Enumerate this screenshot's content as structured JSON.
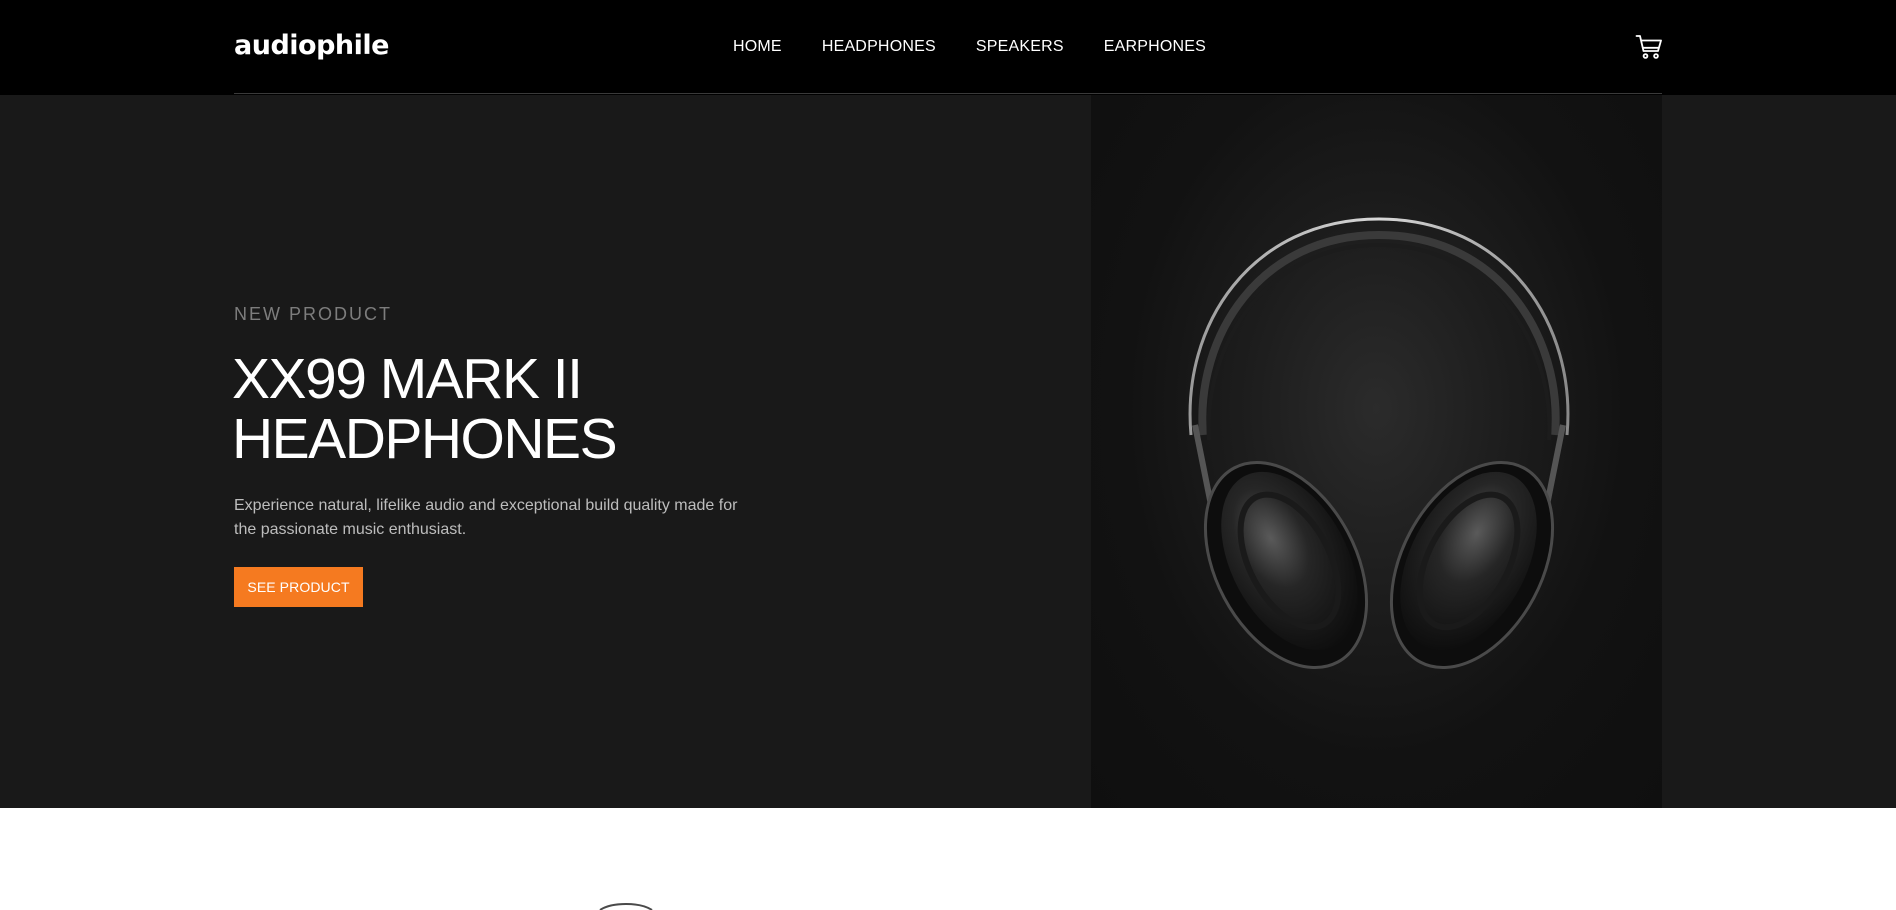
{
  "header": {
    "logo": "audiophile",
    "nav": [
      {
        "label": "HOME"
      },
      {
        "label": "HEADPHONES"
      },
      {
        "label": "SPEAKERS"
      },
      {
        "label": "EARPHONES"
      }
    ],
    "cart_icon": "cart-icon"
  },
  "hero": {
    "overline": "NEW PRODUCT",
    "title_line1": "XX99 MARK II",
    "title_line2": "HEADPHONES",
    "description": "Experience natural, lifelike audio and exceptional build quality made for the passionate music enthusiast.",
    "cta_label": "SEE PRODUCT",
    "image": "headphones-image"
  },
  "colors": {
    "accent": "#f57a20",
    "header_bg": "#000000",
    "hero_bg": "#191919",
    "text_primary": "#ffffff",
    "text_muted": "#7d7d7d"
  }
}
